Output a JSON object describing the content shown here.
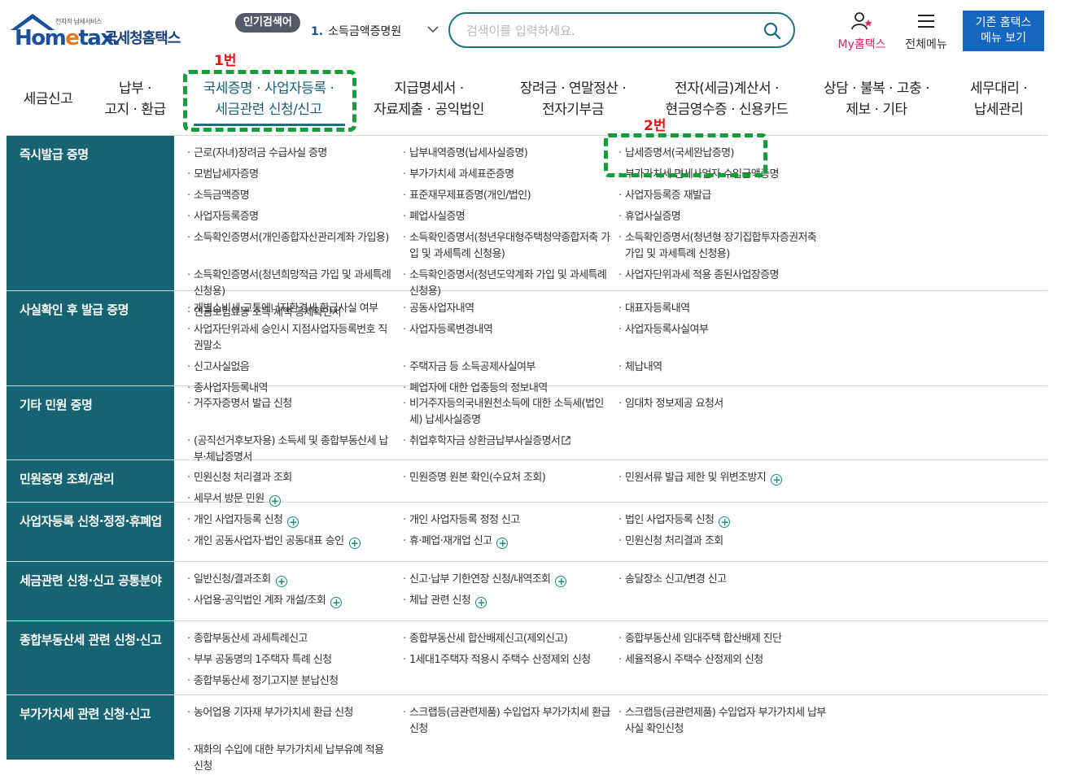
{
  "header": {
    "logo_tagline": "전자적 납세서비스",
    "logo_brand": "Hom",
    "logo_brand_e": "e",
    "logo_brand_end": "tax.",
    "logo_korean": "국세청홈택스",
    "hot_search_label": "인기검색어",
    "hot_search_rank": "1.",
    "hot_search_item": "소득금액증명원",
    "search_placeholder": "검색이를 입력하세요.",
    "my_label": "My홈택스",
    "allmenu_label": "전체메뉴",
    "old_home_line1": "기존 홈택스",
    "old_home_line2": "메뉴 보기"
  },
  "nav": [
    {
      "label": "세금신고"
    },
    {
      "label": "납부 ·\n고지 · 환급"
    },
    {
      "label": "국세증명 · 사업자등록 ·\n세금관련 신청/신고"
    },
    {
      "label": "지급명세서 ·\n자료제출 · 공익법인"
    },
    {
      "label": "장려금 · 연말정산 ·\n전자기부금"
    },
    {
      "label": "전자(세금)계산서 ·\n현금영수증 · 신용카드"
    },
    {
      "label": "상담 · 불복 · 고충 ·\n제보 · 기타"
    },
    {
      "label": "세무대리 ·\n납세관리"
    }
  ],
  "annotations": {
    "first": "1번",
    "second": "2번"
  },
  "sections": [
    {
      "title": "즉시발급 증명",
      "items": [
        {
          "text": "근로(자녀)장려금 수급사실 증명"
        },
        {
          "text": "납부내역증명(납세사실증명)"
        },
        {
          "text": "납세증명서(국세완납증명)"
        },
        {
          "text": "모범납세자증명"
        },
        {
          "text": "부가가치세 과세표준증명"
        },
        {
          "text": "부가가치세 면세사업자 수입금액증명"
        },
        {
          "text": "소득금액증명"
        },
        {
          "text": "표준재무제표증명(개인/법인)"
        },
        {
          "text": "사업자등록증 재발급"
        },
        {
          "text": "사업자등록증명"
        },
        {
          "text": "폐업사실증명"
        },
        {
          "text": "휴업사실증명"
        },
        {
          "text": "소득확인증명서(개인종합자산관리계좌 가입용)"
        },
        {
          "text": "소득확인증명서(청년우대형주택청약종합저축 가입 및 과세특례 신청용)"
        },
        {
          "text": "소득확인증명서(청년형 장기집합투자증권저축 가입 및 과세특례 신청용)"
        },
        {
          "text": "소득확인증명서(청년희망적금 가입 및 과세특례 신청용)"
        },
        {
          "text": "소득확인증명서(청년도약계좌 가입 및 과세특례 신청용)"
        },
        {
          "text": "사업자단위과세 적용 종된사업장증명"
        },
        {
          "text": "연금보험료등 소득·세액 공제확인서"
        }
      ]
    },
    {
      "title": "사실확인 후 발급 증명",
      "items": [
        {
          "text": "개별소비세·교통에너지환경세 환급사실 여부"
        },
        {
          "text": "공동사업자내역"
        },
        {
          "text": "대표자등록내역"
        },
        {
          "text": "사업자단위과세 승인시 지점사업자등록번호 직권말소"
        },
        {
          "text": "사업자등록변경내역"
        },
        {
          "text": "사업자등록사실여부"
        },
        {
          "text": "신고사실없음"
        },
        {
          "text": "주택자금 등 소득공제사실여부"
        },
        {
          "text": "체납내역"
        },
        {
          "text": "종사업자등록내역"
        },
        {
          "text": "폐업자에 대한 업종등의 정보내역"
        }
      ]
    },
    {
      "title": "기타 민원 증명",
      "items": [
        {
          "text": "거주자증명서 발급 신청"
        },
        {
          "text": "비거주자등의국내원천소득에 대한 소득세(법인세) 납세사실증명"
        },
        {
          "text": "임대차 정보제공 요청서"
        },
        {
          "text": "(공직선거후보자용) 소득세 및 종합부동산세 납부·체납증명서"
        },
        {
          "text": "취업후학자금 상환금납부사실증명서",
          "ext": true
        }
      ]
    },
    {
      "title": "민원증명 조회/관리",
      "items": [
        {
          "text": "민원신청 처리결과 조회"
        },
        {
          "text": "민원증명 원본 확인(수요처 조회)"
        },
        {
          "text": "민원서류 발급 제한 및 위변조방지",
          "plus": true
        },
        {
          "text": "세무서 방문 민원",
          "plus": true
        }
      ]
    },
    {
      "title": "사업자등록 신청·정정·휴폐업",
      "items": [
        {
          "text": "개인 사업자등록 신청",
          "plus": true
        },
        {
          "text": "개인 사업자등록 정정 신고"
        },
        {
          "text": "법인 사업자등록 신청",
          "plus": true
        },
        {
          "text": "개인 공동사업자·법인 공동대표 승인",
          "plus": true
        },
        {
          "text": "휴·폐업·재개업 신고",
          "plus": true
        },
        {
          "text": "민원신청 처리결과 조회"
        }
      ]
    },
    {
      "title": "세금관련 신청·신고 공통분야",
      "items": [
        {
          "text": "일반신청/결과조회",
          "plus": true
        },
        {
          "text": "신고·납부 기한연장 신청/내역조회",
          "plus": true
        },
        {
          "text": "송달장소 신고/변경 신고"
        },
        {
          "text": "사업용·공익법인 계좌 개설/조회",
          "plus": true
        },
        {
          "text": "체납 관련 신청",
          "plus": true
        }
      ]
    },
    {
      "title": "종합부동산세 관련 신청·신고",
      "items": [
        {
          "text": "종합부동산세 과세특례신고"
        },
        {
          "text": "종합부동산세 합산배제신고(제외신고)"
        },
        {
          "text": "종합부동산세 임대주택 합산배제 진단"
        },
        {
          "text": "부부 공동명의 1주택자 특례 신청"
        },
        {
          "text": "1세대1주택자 적용시 주택수 산정제외 신청"
        },
        {
          "text": "세율적용시 주택수 산정제외 신청"
        },
        {
          "text": "종합부동산세 정기고지분 분납신청"
        }
      ]
    },
    {
      "title": "부가가치세 관련 신청·신고",
      "items": [
        {
          "text": "농어업용 기자재 부가가치세 환급 신청"
        },
        {
          "text": "스크랩등(금관련제품) 수입업자 부가가치세 환급신청"
        },
        {
          "text": "스크랩등(금관련제품) 수입업자 부가가치세 납부사실 확인신청"
        },
        {
          "text": "재화의 수입에 대한 부가가치세 납부유예 적용 신청"
        }
      ]
    }
  ]
}
